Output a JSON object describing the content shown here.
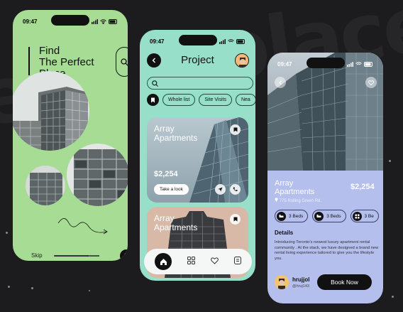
{
  "background_word": "place",
  "colors": {
    "page_bg": "#1c1c1e",
    "phone1_bg": "#a7dc94",
    "phone2_bg": "#97dfc8",
    "phone3_bg": "#b5bfee",
    "accent_dark": "#111111"
  },
  "status_time": "09:47",
  "onboarding": {
    "title_line1": "Find",
    "title_line2": "The Perfect",
    "title_line3": "Place",
    "search_icon": "search-icon",
    "skip_label": "Skip",
    "page_indicator": {
      "active": 1,
      "total": 3
    },
    "next_icon": "arrow-right-icon"
  },
  "project": {
    "title": "Project",
    "search_placeholder": "",
    "filters": [
      "Whole list",
      "Site Visits",
      "Nea"
    ],
    "cards": [
      {
        "name_line1": "Array",
        "name_line2": "Apartments",
        "price": "$2,254",
        "button": "Take a look"
      },
      {
        "name_line1": "Array",
        "name_line2": "Apartments"
      }
    ],
    "nav_icons": [
      "home-icon",
      "grid-icon",
      "heart-icon",
      "document-icon"
    ]
  },
  "detail": {
    "name_line1": "Array",
    "name_line2": "Apartments",
    "price": "$2,254",
    "address": "775 Rolling Green Rd.",
    "beds": [
      "3 Beds",
      "3 Beds",
      "3 Be"
    ],
    "details_heading": "Details",
    "description": "Introducing Toronto's newest luxury apartment rental community . At the stack, we have designed a brand new rental living experience tailored to give you the lifestyle you.",
    "user_name": "hrujjol",
    "user_handle": "@hruj143",
    "book_label": "Book Now"
  }
}
